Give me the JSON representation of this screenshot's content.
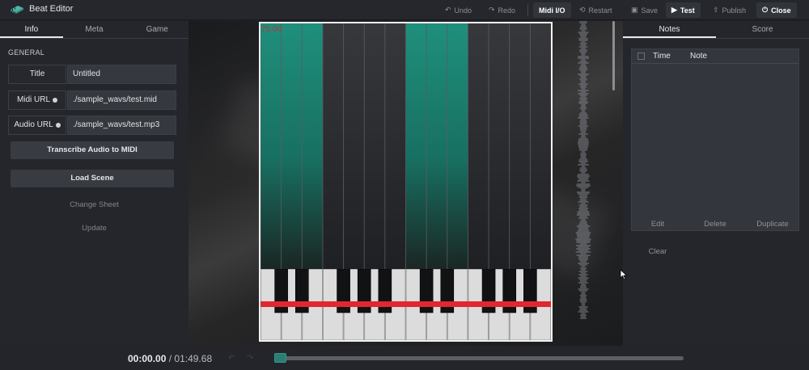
{
  "app": {
    "title": "Beat Editor"
  },
  "toolbar": {
    "undo": "Undo",
    "redo": "Redo",
    "midi_io": "Midi I/O",
    "restart": "Restart",
    "save": "Save",
    "test": "Test",
    "publish": "Publish",
    "close": "Close"
  },
  "left_panel": {
    "tabs": [
      "Info",
      "Meta",
      "Game"
    ],
    "section": "GENERAL",
    "fields": [
      {
        "label": "Title",
        "value": "Untitled"
      },
      {
        "label": "Midi URL",
        "value": "./sample_wavs/test.mid"
      },
      {
        "label": "Audio URL",
        "value": "./sample_wavs/test.mp3"
      }
    ],
    "buttons": [
      "Transcribe Audio to MIDI",
      "Load Scene"
    ],
    "links": [
      "Change Sheet",
      "Update"
    ]
  },
  "game": {
    "score": "75.00",
    "highlight_color": "#1f8f7b"
  },
  "right_panel": {
    "tabs": [
      "Notes",
      "Score"
    ],
    "columns": [
      "Time",
      "Note"
    ],
    "actions": [
      "Edit",
      "Delete",
      "Duplicate",
      "Clear"
    ]
  },
  "playback": {
    "current": "00:00.00",
    "separator": "/",
    "duration": "01:49.68",
    "progress": 0.0
  },
  "colors": {
    "accent": "#2e7d74",
    "marker": "#e0282e"
  }
}
